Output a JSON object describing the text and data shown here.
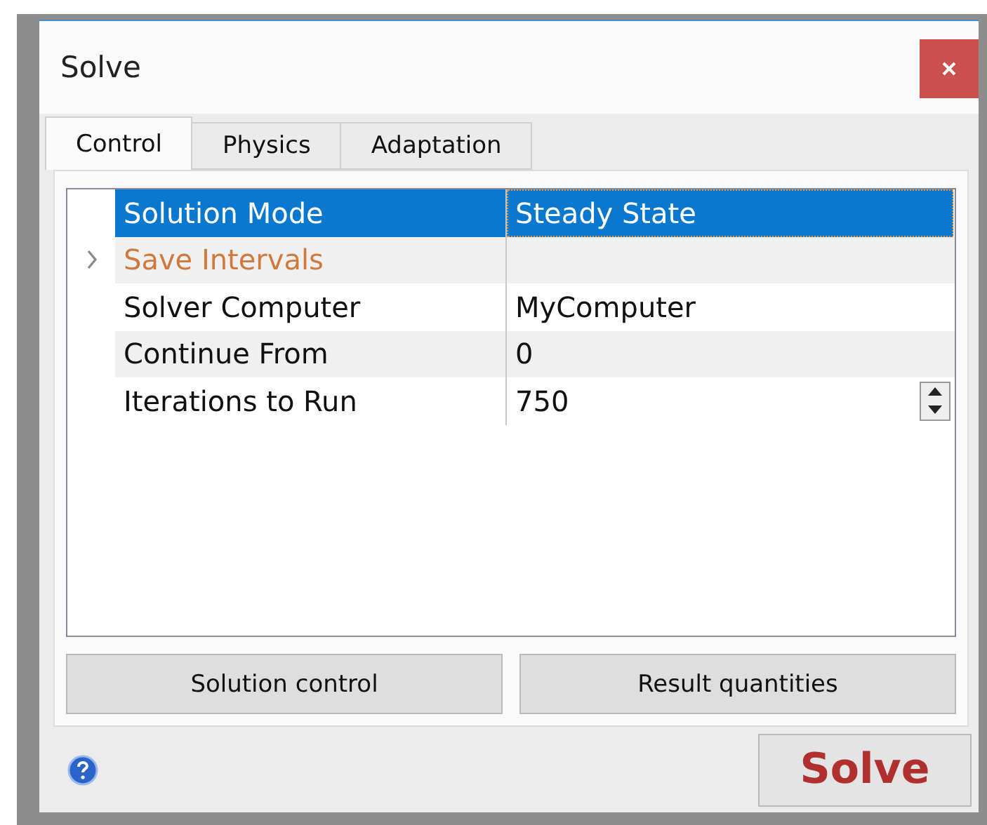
{
  "window": {
    "title": "Solve"
  },
  "tabs": [
    {
      "label": "Control",
      "selected": true
    },
    {
      "label": "Physics",
      "selected": false
    },
    {
      "label": "Adaptation",
      "selected": false
    }
  ],
  "properties": [
    {
      "kind": "text",
      "name": "Solution Mode",
      "value": "Steady State",
      "selected": true
    },
    {
      "kind": "group",
      "name": "Save Intervals",
      "expanded": false,
      "selected": false
    },
    {
      "kind": "text",
      "name": "Solver Computer",
      "value": "MyComputer",
      "selected": false
    },
    {
      "kind": "text",
      "name": "Continue From",
      "value": "0",
      "selected": false
    },
    {
      "kind": "spin",
      "name": "Iterations to Run",
      "value": "750",
      "selected": false
    }
  ],
  "panel_buttons": [
    "Solution control",
    "Result quantities"
  ],
  "solve_button": "Solve"
}
